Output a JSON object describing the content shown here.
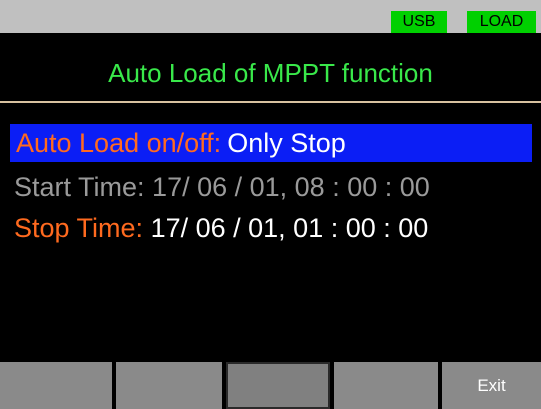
{
  "status_bar": {
    "usb_label": "USB",
    "load_label": "LOAD",
    "badge_color": "#00d000"
  },
  "title": "Auto Load of MPPT function",
  "settings": {
    "auto_load": {
      "label": "Auto Load on/off:",
      "value": "Only Stop",
      "selected": true
    },
    "start_time": {
      "label": "Start Time:",
      "value": "17/ 06 / 01, 08 : 00 : 00",
      "enabled": false
    },
    "stop_time": {
      "label": "Stop Time:",
      "value": "17/ 06 / 01, 01 : 00 : 00",
      "enabled": true
    }
  },
  "softkeys": [
    "",
    "",
    "",
    "",
    "Exit"
  ],
  "colors": {
    "title": "#39e84a",
    "label_active": "#ff6a1f",
    "label_disabled": "#9a9a9a",
    "selection": "#0b1ef5"
  }
}
